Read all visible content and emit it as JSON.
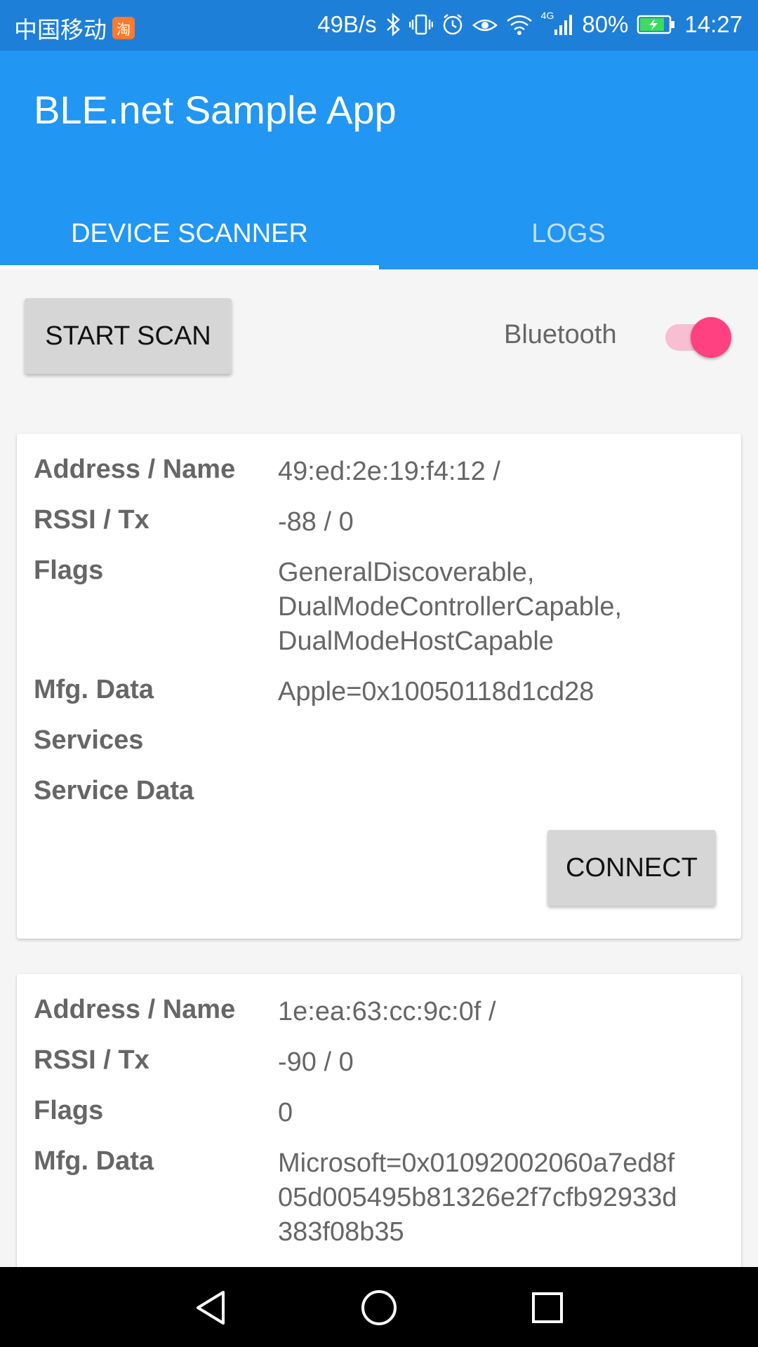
{
  "status_bar": {
    "carrier": "中国移动",
    "app_badge": "淘",
    "net_speed": "49B/s",
    "network": "4G",
    "battery": "80%",
    "time": "14:27"
  },
  "app": {
    "title": "BLE.net Sample App",
    "tabs": [
      "DEVICE SCANNER",
      "LOGS"
    ],
    "active_tab": "DEVICE SCANNER"
  },
  "controls": {
    "start_scan_label": "START SCAN",
    "bluetooth_label": "Bluetooth",
    "bluetooth_on": true
  },
  "devices": [
    {
      "labels": {
        "address": "Address / Name",
        "rssi": "RSSI / Tx",
        "flags": "Flags",
        "mfg": "Mfg. Data",
        "services": "Services",
        "service_data": "Service Data"
      },
      "address": "49:ed:2e:19:f4:12 /",
      "rssi": "-88 / 0",
      "flags_lines": [
        "GeneralDiscoverable,",
        "DualModeControllerCapable,",
        "DualModeHostCapable"
      ],
      "mfg": "Apple=0x10050118d1cd28",
      "services": "",
      "service_data": "",
      "connect_label": "CONNECT"
    },
    {
      "labels": {
        "address": "Address / Name",
        "rssi": "RSSI / Tx",
        "flags": "Flags",
        "mfg": "Mfg. Data"
      },
      "address": "1e:ea:63:cc:9c:0f /",
      "rssi": "-90 / 0",
      "flags": "0",
      "mfg_lines": [
        "Microsoft=0x01092002060a7ed8f",
        "05d005495b81326e2f7cfb92933d",
        "383f08b35"
      ]
    }
  ],
  "accent_colors": {
    "primary": "#2196f3",
    "status_bar": "#1e7fd8",
    "accent": "#ff4081"
  }
}
